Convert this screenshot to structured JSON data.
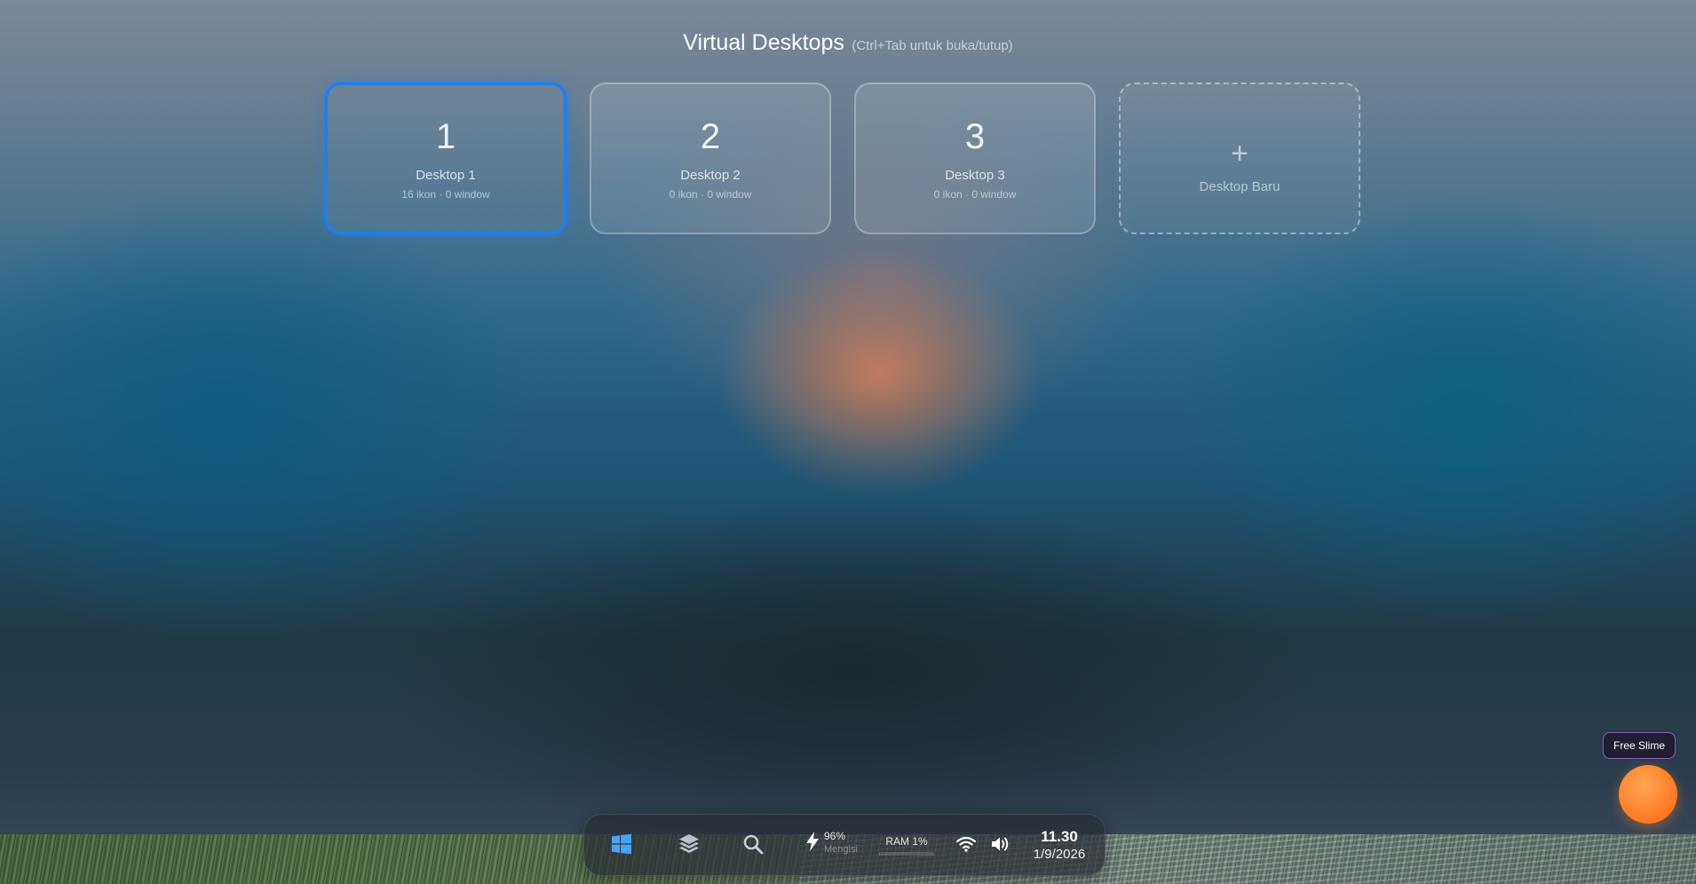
{
  "overlay": {
    "title": "Virtual Desktops",
    "hint": "(Ctrl+Tab untuk buka/tutup)"
  },
  "desktops": [
    {
      "number": "1",
      "name": "Desktop 1",
      "meta": "16 ikon · 0 window",
      "active": true
    },
    {
      "number": "2",
      "name": "Desktop 2",
      "meta": "0 ikon · 0 window",
      "active": false
    },
    {
      "number": "3",
      "name": "Desktop 3",
      "meta": "0 ikon · 0 window",
      "active": false
    }
  ],
  "new_desktop": {
    "icon": "+",
    "label": "Desktop Baru"
  },
  "taskbar": {
    "icons": {
      "start": "windows-icon",
      "desktops": "layers-icon",
      "search": "search-icon",
      "battery": "lightning-icon",
      "wifi": "wifi-icon",
      "volume": "volume-icon"
    },
    "battery_percent": "96%",
    "battery_status": "Mengisi",
    "ram_label": "RAM 1%",
    "ram_fraction": 0.01,
    "time": "11.30",
    "date": "1/9/2026"
  },
  "slime": {
    "label": "Free Slime"
  },
  "colors": {
    "accent": "#1f7ff0",
    "start_icon": "#4aa3ff",
    "slime": "#ff8a2e",
    "slime_border": "#aa6edc"
  }
}
